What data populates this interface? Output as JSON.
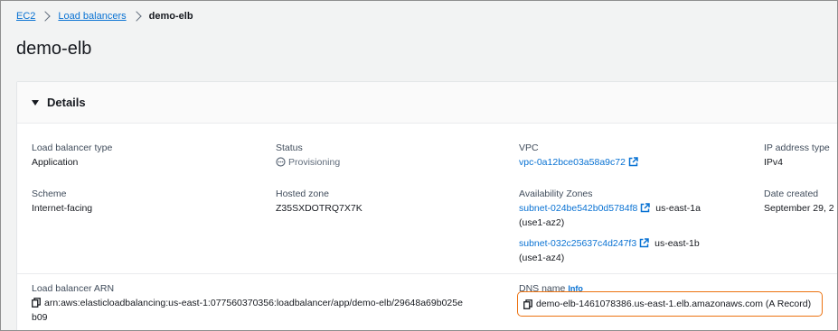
{
  "breadcrumb": {
    "items": [
      "EC2",
      "Load balancers"
    ],
    "current": "demo-elb"
  },
  "page_title": "demo-elb",
  "details": {
    "title": "Details",
    "load_balancer_type": {
      "label": "Load balancer type",
      "value": "Application"
    },
    "status": {
      "label": "Status",
      "value": "Provisioning"
    },
    "vpc": {
      "label": "VPC",
      "value": "vpc-0a12bce03a58a9c72"
    },
    "ip_address_type": {
      "label": "IP address type",
      "value": "IPv4"
    },
    "scheme": {
      "label": "Scheme",
      "value": "Internet-facing"
    },
    "hosted_zone": {
      "label": "Hosted zone",
      "value": "Z35SXDOTRQ7X7K"
    },
    "availability_zones": {
      "label": "Availability Zones",
      "zones": [
        {
          "subnet": "subnet-024be542b0d5784f8",
          "zone": "us-east-1a",
          "zone_id": "(use1-az2)"
        },
        {
          "subnet": "subnet-032c25637c4d247f3",
          "zone": "us-east-1b",
          "zone_id": "(use1-az4)"
        }
      ]
    },
    "date_created": {
      "label": "Date created",
      "value": "September 29, 2"
    },
    "arn": {
      "label": "Load balancer ARN",
      "line1": "arn:aws:elasticloadbalancing:us-east-1:077560370356:loadbalancer/app/demo-elb/29648a69b025e",
      "line2": "b09"
    },
    "dns_name": {
      "label": "DNS name",
      "info": "Info",
      "value": "demo-elb-1461078386.us-east-1.elb.amazonaws.com (A Record)"
    }
  },
  "colors": {
    "link": "#0972d3",
    "highlight_border": "#ec7211"
  },
  "icons": [
    "chevron-right-icon",
    "caret-down-icon",
    "status-pending-icon",
    "external-link-icon",
    "copy-icon"
  ]
}
